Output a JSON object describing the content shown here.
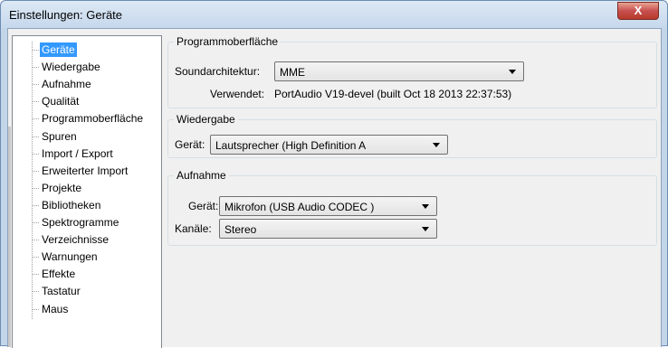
{
  "window": {
    "title": "Einstellungen: Geräte",
    "close_label": "X"
  },
  "tree": {
    "items": [
      "Geräte",
      "Wiedergabe",
      "Aufnahme",
      "Qualität",
      "Programmoberfläche",
      "Spuren",
      "Import / Export",
      "Erweiterter Import",
      "Projekte",
      "Bibliotheken",
      "Spektrogramme",
      "Verzeichnisse",
      "Warnungen",
      "Effekte",
      "Tastatur",
      "Maus"
    ],
    "selected": "Geräte"
  },
  "interface_group": {
    "title": "Programmoberfläche",
    "host_label": "Soundarchitektur:",
    "host_value": "MME",
    "using_label": "Verwendet:",
    "using_value": "PortAudio V19-devel (built Oct 18 2013 22:37:53)"
  },
  "playback_group": {
    "title": "Wiedergabe",
    "device_label": "Gerät:",
    "device_value": "Lautsprecher (High Definition A"
  },
  "recording_group": {
    "title": "Aufnahme",
    "device_label": "Gerät:",
    "device_value": "Mikrofon (USB Audio CODEC )",
    "channels_label": "Kanäle:",
    "channels_value": "Stereo"
  }
}
